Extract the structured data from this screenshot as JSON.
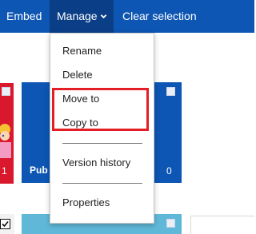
{
  "toolbar": {
    "embed_label": "Embed",
    "manage_label": "Manage",
    "clear_label": "Clear selection"
  },
  "menu": {
    "items": [
      "Rename",
      "Delete",
      "Move to",
      "Copy to",
      "Version history",
      "Properties"
    ]
  },
  "tiles": {
    "tile1_count": "1",
    "tile2_count": "0",
    "tile_label": "Pub"
  },
  "colors": {
    "command_bar": "#0d56b3",
    "manage_active": "#0a3f87",
    "tile_red": "#d9182d",
    "tile_teal": "#5fb8d8",
    "highlight": "#e31e24"
  }
}
